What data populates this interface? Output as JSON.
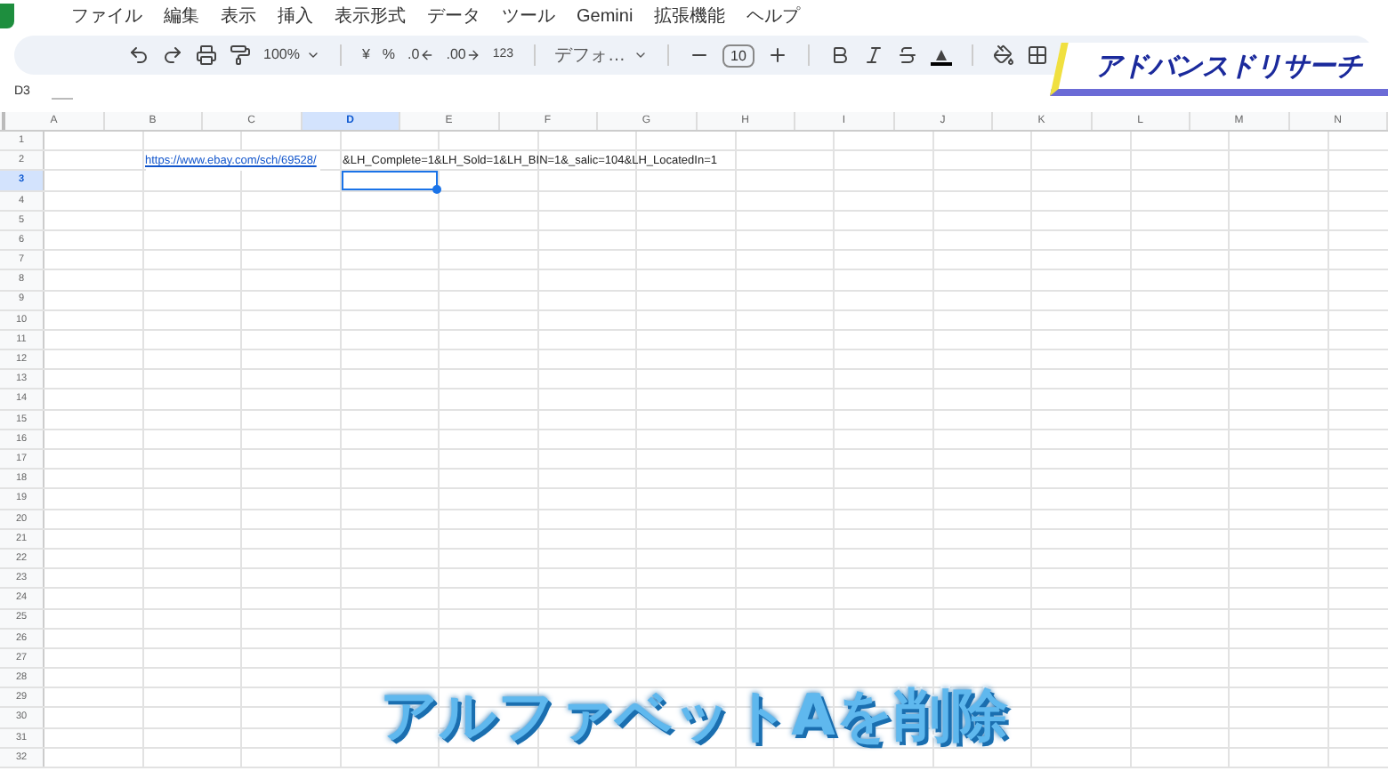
{
  "menu": [
    "ファイル",
    "編集",
    "表示",
    "挿入",
    "表示形式",
    "データ",
    "ツール",
    "Gemini",
    "拡張機能",
    "ヘルプ"
  ],
  "toolbar": {
    "zoom": "100%",
    "currency": "¥",
    "percent": "%",
    "decimal_decrease": ".0",
    "decimal_increase": ".00",
    "number_format": "123",
    "font": "デフォ…",
    "font_size": "10"
  },
  "name_box": "D3",
  "sheet": {
    "columns": [
      {
        "label": "A",
        "selected": false
      },
      {
        "label": "B",
        "selected": false
      },
      {
        "label": "C",
        "selected": false
      },
      {
        "label": "D",
        "selected": true
      },
      {
        "label": "E",
        "selected": false
      },
      {
        "label": "F",
        "selected": false
      },
      {
        "label": "G",
        "selected": false
      },
      {
        "label": "H",
        "selected": false
      },
      {
        "label": "I",
        "selected": false
      },
      {
        "label": "J",
        "selected": false
      },
      {
        "label": "K",
        "selected": false
      },
      {
        "label": "L",
        "selected": false
      },
      {
        "label": "M",
        "selected": false
      },
      {
        "label": "N",
        "selected": false
      }
    ],
    "rows": [
      {
        "label": "1",
        "selected": false
      },
      {
        "label": "2",
        "selected": false,
        "cells": [
          {
            "kind": "empty",
            "selected": false
          },
          {
            "kind": "link",
            "text": "https://www.ebay.com/sch/69528/",
            "selected": false
          },
          {
            "kind": "empty",
            "selected": false
          },
          {
            "kind": "text",
            "text": "&LH_Complete=1&LH_Sold=1&LH_BIN=1&_salic=104&LH_LocatedIn=1",
            "selected": false
          }
        ]
      },
      {
        "label": "3",
        "selected": true,
        "cells": [
          {
            "kind": "empty",
            "selected": false
          },
          {
            "kind": "empty",
            "selected": false
          },
          {
            "kind": "empty",
            "selected": false
          },
          {
            "kind": "empty",
            "selected": true
          }
        ]
      },
      {
        "label": "4",
        "selected": false
      },
      {
        "label": "5",
        "selected": false
      },
      {
        "label": "6",
        "selected": false
      },
      {
        "label": "7",
        "selected": false
      },
      {
        "label": "8",
        "selected": false
      },
      {
        "label": "9",
        "selected": false
      },
      {
        "label": "10",
        "selected": false
      },
      {
        "label": "11",
        "selected": false
      },
      {
        "label": "12",
        "selected": false
      },
      {
        "label": "13",
        "selected": false
      },
      {
        "label": "14",
        "selected": false
      },
      {
        "label": "15",
        "selected": false
      },
      {
        "label": "16",
        "selected": false
      },
      {
        "label": "17",
        "selected": false
      },
      {
        "label": "18",
        "selected": false
      },
      {
        "label": "19",
        "selected": false
      },
      {
        "label": "20",
        "selected": false
      },
      {
        "label": "21",
        "selected": false
      },
      {
        "label": "22",
        "selected": false
      },
      {
        "label": "23",
        "selected": false
      },
      {
        "label": "24",
        "selected": false
      },
      {
        "label": "25",
        "selected": false
      },
      {
        "label": "26",
        "selected": false
      },
      {
        "label": "27",
        "selected": false
      },
      {
        "label": "28",
        "selected": false
      },
      {
        "label": "29",
        "selected": false
      },
      {
        "label": "30",
        "selected": false
      },
      {
        "label": "31",
        "selected": false
      },
      {
        "label": "32",
        "selected": false
      }
    ]
  },
  "video_title": "アドバンスドリサーチ",
  "caption": "アルファベットAを削除"
}
